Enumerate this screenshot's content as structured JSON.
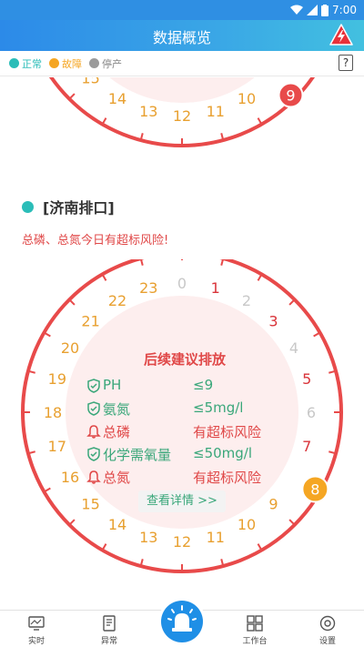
{
  "status_bar": {
    "time": "7:00"
  },
  "header": {
    "title": "数据概览"
  },
  "legend": {
    "items": [
      {
        "label": "正常",
        "color": "#2bbdb8"
      },
      {
        "label": "故障",
        "color": "#f5a623"
      },
      {
        "label": "停产",
        "color": "#9b9b9b"
      }
    ],
    "help": "?"
  },
  "top_dial": {
    "hours": [
      "15",
      "14",
      "13",
      "12",
      "11",
      "10",
      "9"
    ],
    "highlight_hour": "9"
  },
  "site": {
    "name": "[济南排口]",
    "risk": "总磷、总氮今日有超标风险!"
  },
  "dial": {
    "hours": [
      "0",
      "1",
      "2",
      "3",
      "4",
      "5",
      "6",
      "7",
      "8",
      "9",
      "10",
      "11",
      "12",
      "13",
      "14",
      "15",
      "16",
      "17",
      "18",
      "19",
      "20",
      "21",
      "22",
      "23"
    ],
    "current_hour": "8",
    "alert_hours": [
      "1",
      "3",
      "5",
      "7"
    ],
    "future_hours": [
      "0",
      "2",
      "4",
      "6"
    ]
  },
  "advice": {
    "title": "后续建议排放",
    "rows": [
      {
        "name": "PH",
        "value": "≤9",
        "status": "ok"
      },
      {
        "name": "氨氮",
        "value": "≤5mg/l",
        "status": "ok"
      },
      {
        "name": "总磷",
        "value": "有超标风险",
        "status": "bad"
      },
      {
        "name": "化学需氧量",
        "value": "≤50mg/l",
        "status": "ok"
      },
      {
        "name": "总氮",
        "value": "有超标风险",
        "status": "bad"
      }
    ],
    "details_button": "查看详情 >>"
  },
  "tabbar": {
    "tabs": [
      {
        "label": "实时",
        "icon": "monitor-icon"
      },
      {
        "label": "异常",
        "icon": "alert-doc-icon"
      },
      {
        "label": "",
        "icon": "siren-icon"
      },
      {
        "label": "工作台",
        "icon": "grid-icon"
      },
      {
        "label": "设置",
        "icon": "settings-icon"
      }
    ]
  },
  "colors": {
    "brand_blue": "#2c8ae8",
    "alarm_red": "#e84a4a",
    "ok_green": "#3aa77a",
    "hour_orange": "#e8a030",
    "current_orange": "#f5a623"
  }
}
